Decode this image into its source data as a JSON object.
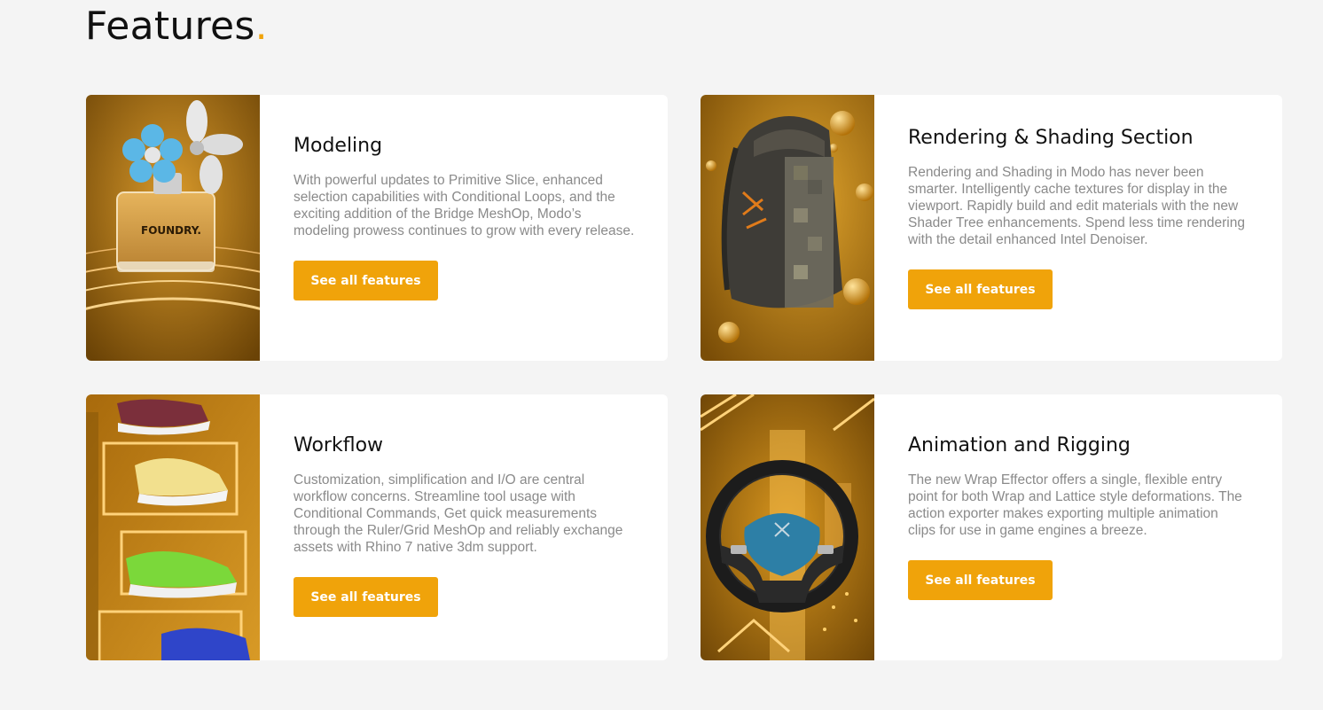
{
  "page": {
    "heading": "Features",
    "heading_dot": ".",
    "accent_color": "#f0a30a"
  },
  "features": [
    {
      "title": "Modeling",
      "description": "With powerful updates to Primitive Slice, enhanced selection capabilities with Conditional Loops, and the exciting addition of the Bridge MeshOp, Modo’s modeling prowess continues to grow with every release.",
      "button_label": "See all features",
      "image": "perfume-bottle-image",
      "image_text": "FOUNDRY."
    },
    {
      "title": "Rendering & Shading Section",
      "description": "Rendering and Shading in Modo has never been smarter. Intelligently cache textures for display in the viewport. Rapidly build and edit materials with the new Shader Tree enhancements. Spend less time rendering with the detail enhanced Intel Denoiser.",
      "button_label": "See all features",
      "image": "backpack-image"
    },
    {
      "title": "Workflow",
      "description": "Customization, simplification and I/O are central workflow concerns. Streamline tool usage with Conditional Commands, Get quick measurements through the Ruler/Grid MeshOp and reliably exchange assets with Rhino 7 native 3dm support.",
      "button_label": "See all features",
      "image": "sneakers-image"
    },
    {
      "title": "Animation and Rigging",
      "description": "The new Wrap Effector offers a single, flexible entry point for both Wrap and Lattice style deformations. The action exporter makes exporting multiple animation clips for use in game engines a breeze.",
      "button_label": "See all features",
      "image": "steering-wheel-image"
    }
  ]
}
